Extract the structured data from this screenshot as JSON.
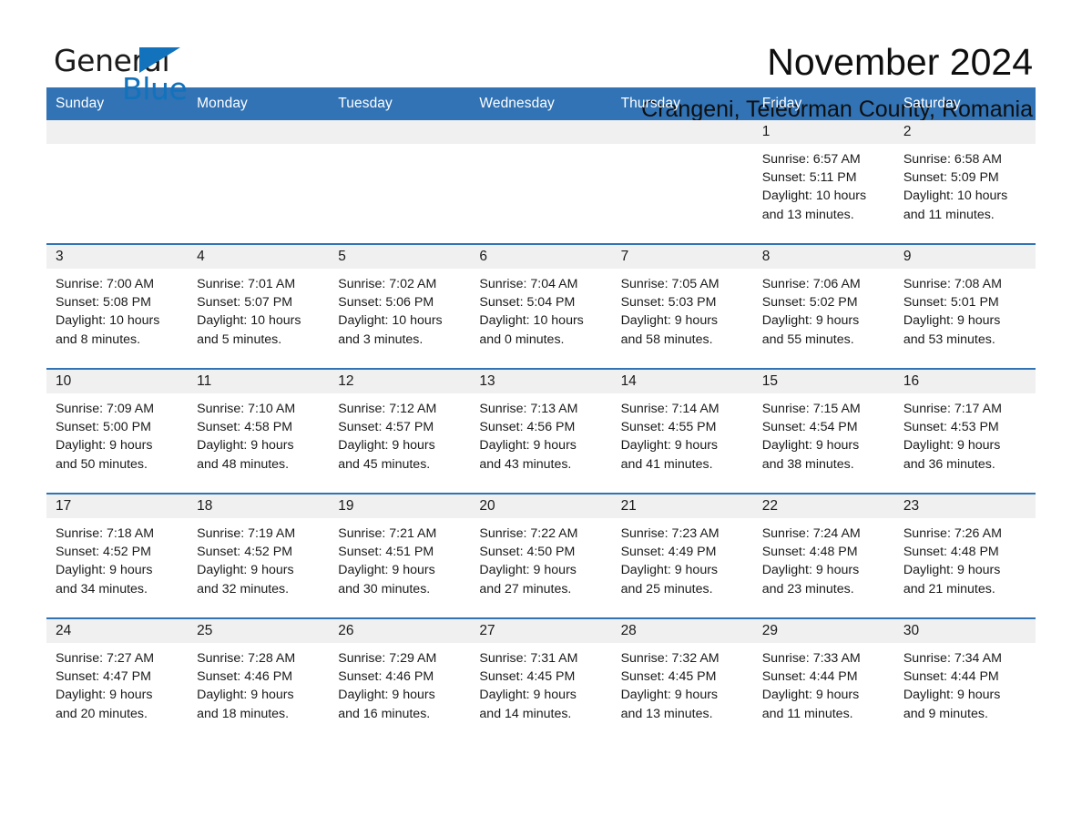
{
  "brand": {
    "name_part1": "General",
    "name_part2": "Blue",
    "triangle_color": "#1272bc"
  },
  "header": {
    "month_title": "November 2024",
    "location": "Crangeni, Teleorman County, Romania"
  },
  "theme": {
    "header_blue": "#3173b5",
    "day_band_gray": "#f0f0f0",
    "divider_blue": "#3173b5",
    "text_color": "#1a1a1a"
  },
  "calendar": {
    "weekday_headers": [
      "Sunday",
      "Monday",
      "Tuesday",
      "Wednesday",
      "Thursday",
      "Friday",
      "Saturday"
    ],
    "weeks": [
      [
        {
          "day": "",
          "empty": true
        },
        {
          "day": "",
          "empty": true
        },
        {
          "day": "",
          "empty": true
        },
        {
          "day": "",
          "empty": true
        },
        {
          "day": "",
          "empty": true
        },
        {
          "day": "1",
          "sunrise": "Sunrise: 6:57 AM",
          "sunset": "Sunset: 5:11 PM",
          "daylight_line1": "Daylight: 10 hours",
          "daylight_line2": "and 13 minutes."
        },
        {
          "day": "2",
          "sunrise": "Sunrise: 6:58 AM",
          "sunset": "Sunset: 5:09 PM",
          "daylight_line1": "Daylight: 10 hours",
          "daylight_line2": "and 11 minutes."
        }
      ],
      [
        {
          "day": "3",
          "sunrise": "Sunrise: 7:00 AM",
          "sunset": "Sunset: 5:08 PM",
          "daylight_line1": "Daylight: 10 hours",
          "daylight_line2": "and 8 minutes."
        },
        {
          "day": "4",
          "sunrise": "Sunrise: 7:01 AM",
          "sunset": "Sunset: 5:07 PM",
          "daylight_line1": "Daylight: 10 hours",
          "daylight_line2": "and 5 minutes."
        },
        {
          "day": "5",
          "sunrise": "Sunrise: 7:02 AM",
          "sunset": "Sunset: 5:06 PM",
          "daylight_line1": "Daylight: 10 hours",
          "daylight_line2": "and 3 minutes."
        },
        {
          "day": "6",
          "sunrise": "Sunrise: 7:04 AM",
          "sunset": "Sunset: 5:04 PM",
          "daylight_line1": "Daylight: 10 hours",
          "daylight_line2": "and 0 minutes."
        },
        {
          "day": "7",
          "sunrise": "Sunrise: 7:05 AM",
          "sunset": "Sunset: 5:03 PM",
          "daylight_line1": "Daylight: 9 hours",
          "daylight_line2": "and 58 minutes."
        },
        {
          "day": "8",
          "sunrise": "Sunrise: 7:06 AM",
          "sunset": "Sunset: 5:02 PM",
          "daylight_line1": "Daylight: 9 hours",
          "daylight_line2": "and 55 minutes."
        },
        {
          "day": "9",
          "sunrise": "Sunrise: 7:08 AM",
          "sunset": "Sunset: 5:01 PM",
          "daylight_line1": "Daylight: 9 hours",
          "daylight_line2": "and 53 minutes."
        }
      ],
      [
        {
          "day": "10",
          "sunrise": "Sunrise: 7:09 AM",
          "sunset": "Sunset: 5:00 PM",
          "daylight_line1": "Daylight: 9 hours",
          "daylight_line2": "and 50 minutes."
        },
        {
          "day": "11",
          "sunrise": "Sunrise: 7:10 AM",
          "sunset": "Sunset: 4:58 PM",
          "daylight_line1": "Daylight: 9 hours",
          "daylight_line2": "and 48 minutes."
        },
        {
          "day": "12",
          "sunrise": "Sunrise: 7:12 AM",
          "sunset": "Sunset: 4:57 PM",
          "daylight_line1": "Daylight: 9 hours",
          "daylight_line2": "and 45 minutes."
        },
        {
          "day": "13",
          "sunrise": "Sunrise: 7:13 AM",
          "sunset": "Sunset: 4:56 PM",
          "daylight_line1": "Daylight: 9 hours",
          "daylight_line2": "and 43 minutes."
        },
        {
          "day": "14",
          "sunrise": "Sunrise: 7:14 AM",
          "sunset": "Sunset: 4:55 PM",
          "daylight_line1": "Daylight: 9 hours",
          "daylight_line2": "and 41 minutes."
        },
        {
          "day": "15",
          "sunrise": "Sunrise: 7:15 AM",
          "sunset": "Sunset: 4:54 PM",
          "daylight_line1": "Daylight: 9 hours",
          "daylight_line2": "and 38 minutes."
        },
        {
          "day": "16",
          "sunrise": "Sunrise: 7:17 AM",
          "sunset": "Sunset: 4:53 PM",
          "daylight_line1": "Daylight: 9 hours",
          "daylight_line2": "and 36 minutes."
        }
      ],
      [
        {
          "day": "17",
          "sunrise": "Sunrise: 7:18 AM",
          "sunset": "Sunset: 4:52 PM",
          "daylight_line1": "Daylight: 9 hours",
          "daylight_line2": "and 34 minutes."
        },
        {
          "day": "18",
          "sunrise": "Sunrise: 7:19 AM",
          "sunset": "Sunset: 4:52 PM",
          "daylight_line1": "Daylight: 9 hours",
          "daylight_line2": "and 32 minutes."
        },
        {
          "day": "19",
          "sunrise": "Sunrise: 7:21 AM",
          "sunset": "Sunset: 4:51 PM",
          "daylight_line1": "Daylight: 9 hours",
          "daylight_line2": "and 30 minutes."
        },
        {
          "day": "20",
          "sunrise": "Sunrise: 7:22 AM",
          "sunset": "Sunset: 4:50 PM",
          "daylight_line1": "Daylight: 9 hours",
          "daylight_line2": "and 27 minutes."
        },
        {
          "day": "21",
          "sunrise": "Sunrise: 7:23 AM",
          "sunset": "Sunset: 4:49 PM",
          "daylight_line1": "Daylight: 9 hours",
          "daylight_line2": "and 25 minutes."
        },
        {
          "day": "22",
          "sunrise": "Sunrise: 7:24 AM",
          "sunset": "Sunset: 4:48 PM",
          "daylight_line1": "Daylight: 9 hours",
          "daylight_line2": "and 23 minutes."
        },
        {
          "day": "23",
          "sunrise": "Sunrise: 7:26 AM",
          "sunset": "Sunset: 4:48 PM",
          "daylight_line1": "Daylight: 9 hours",
          "daylight_line2": "and 21 minutes."
        }
      ],
      [
        {
          "day": "24",
          "sunrise": "Sunrise: 7:27 AM",
          "sunset": "Sunset: 4:47 PM",
          "daylight_line1": "Daylight: 9 hours",
          "daylight_line2": "and 20 minutes."
        },
        {
          "day": "25",
          "sunrise": "Sunrise: 7:28 AM",
          "sunset": "Sunset: 4:46 PM",
          "daylight_line1": "Daylight: 9 hours",
          "daylight_line2": "and 18 minutes."
        },
        {
          "day": "26",
          "sunrise": "Sunrise: 7:29 AM",
          "sunset": "Sunset: 4:46 PM",
          "daylight_line1": "Daylight: 9 hours",
          "daylight_line2": "and 16 minutes."
        },
        {
          "day": "27",
          "sunrise": "Sunrise: 7:31 AM",
          "sunset": "Sunset: 4:45 PM",
          "daylight_line1": "Daylight: 9 hours",
          "daylight_line2": "and 14 minutes."
        },
        {
          "day": "28",
          "sunrise": "Sunrise: 7:32 AM",
          "sunset": "Sunset: 4:45 PM",
          "daylight_line1": "Daylight: 9 hours",
          "daylight_line2": "and 13 minutes."
        },
        {
          "day": "29",
          "sunrise": "Sunrise: 7:33 AM",
          "sunset": "Sunset: 4:44 PM",
          "daylight_line1": "Daylight: 9 hours",
          "daylight_line2": "and 11 minutes."
        },
        {
          "day": "30",
          "sunrise": "Sunrise: 7:34 AM",
          "sunset": "Sunset: 4:44 PM",
          "daylight_line1": "Daylight: 9 hours",
          "daylight_line2": "and 9 minutes."
        }
      ]
    ]
  }
}
